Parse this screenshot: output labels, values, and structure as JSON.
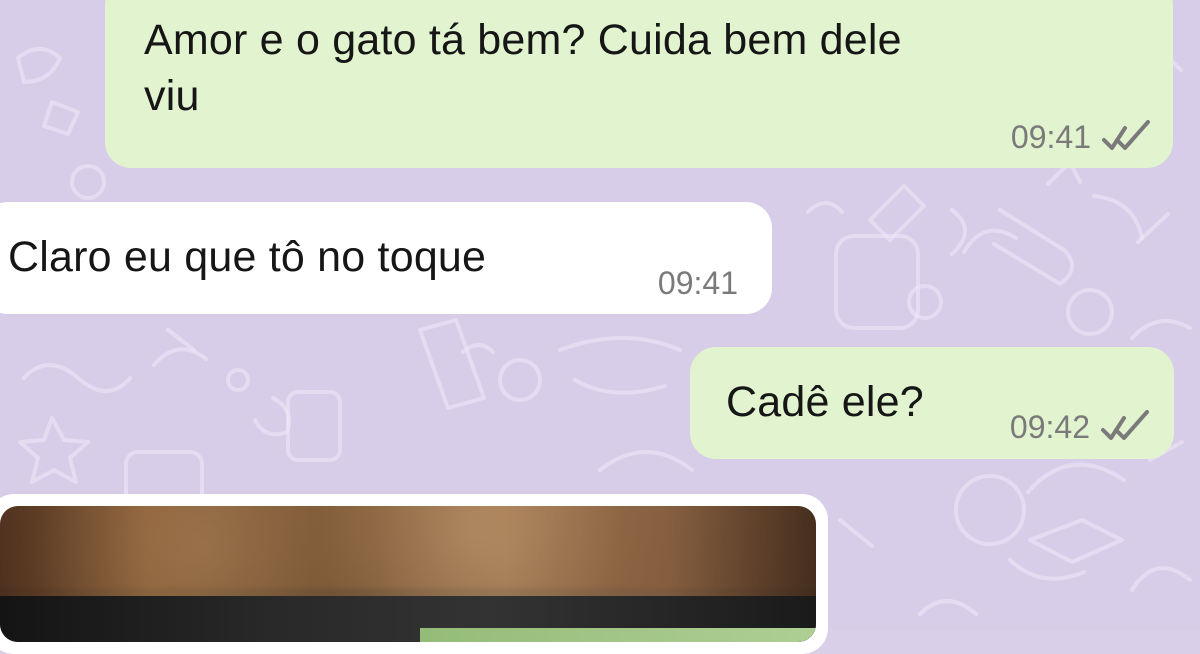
{
  "chat": {
    "messages": [
      {
        "direction": "outgoing",
        "text": "Amor e o gato tá bem? Cuida bem dele\nviu",
        "time": "09:41",
        "status": "read-double-check"
      },
      {
        "direction": "incoming",
        "text": "Claro eu que tô no toque",
        "time": "09:41"
      },
      {
        "direction": "outgoing",
        "text": "Cadê ele?",
        "time": "09:42",
        "status": "read-double-check"
      }
    ],
    "image_message": {
      "type": "photo",
      "description_visible": ""
    }
  },
  "colors": {
    "background": "#d8cde8",
    "outgoing_bubble": "#e2f3cf",
    "incoming_bubble": "#ffffff",
    "meta_text": "#7a7a7a"
  },
  "icons": {
    "read_receipt": "double-check-icon"
  }
}
